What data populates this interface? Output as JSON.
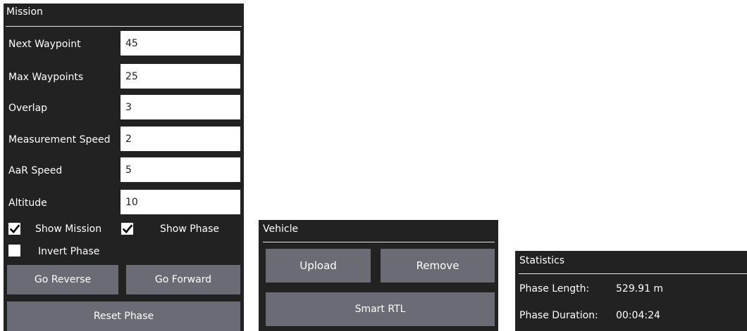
{
  "mission": {
    "title": "Mission",
    "fields": [
      {
        "label": "Next Waypoint",
        "value": "45"
      },
      {
        "label": "Max Waypoints",
        "value": "25"
      },
      {
        "label": "Overlap",
        "value": "3"
      },
      {
        "label": "Measurement Speed",
        "value": "2"
      },
      {
        "label": "AaR Speed",
        "value": "5"
      },
      {
        "label": "Altitude",
        "value": "10"
      }
    ],
    "show_mission": {
      "label": "Show Mission",
      "checked": true
    },
    "show_phase": {
      "label": "Show Phase",
      "checked": true
    },
    "invert_phase": {
      "label": "Invert Phase",
      "checked": false
    },
    "go_reverse_label": "Go Reverse",
    "go_forward_label": "Go Forward",
    "reset_phase_label": "Reset Phase"
  },
  "vehicle": {
    "title": "Vehicle",
    "upload_label": "Upload",
    "remove_label": "Remove",
    "smart_rtl_label": "Smart RTL"
  },
  "statistics": {
    "title": "Statistics",
    "phase_length_label": "Phase Length:",
    "phase_length_value": "529.91 m",
    "phase_duration_label": "Phase Duration:",
    "phase_duration_value": "00:04:24"
  },
  "colors": {
    "panel_bg": "#222222",
    "button_bg": "#6b6b75",
    "text": "#ffffff"
  }
}
